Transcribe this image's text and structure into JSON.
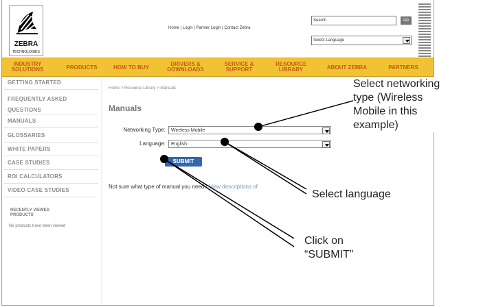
{
  "header": {
    "logo_text": "ZEBRA",
    "logo_subtext": "TECHNOLOGIES",
    "links": "Home | Login | Partner Login | Contact Zebra",
    "search_text": "Search",
    "go_label": "GO",
    "language_select": "Select Language"
  },
  "nav": {
    "items": [
      "INDUSTRY\nSOLUTIONS",
      "PRODUCTS",
      "HOW TO BUY",
      "DRIVERS &\nDOWNLOADS",
      "SERVICE &\nSUPPORT",
      "RESOURCE\nLIBRARY",
      "ABOUT ZEBRA",
      "PARTNERS"
    ]
  },
  "sidebar": {
    "items": [
      "GETTING STARTED",
      "FREQUENTLY ASKED\nQUESTIONS",
      "MANUALS",
      "GLOSSARIES",
      "WHITE PAPERS",
      "CASE STUDIES",
      "ROI CALCULATORS",
      "VIDEO CASE STUDIES"
    ],
    "recent_title": "RECENTLY VIEWED\nPRODUCTS",
    "recent_text": "No products have been viewed"
  },
  "main": {
    "breadcrumb": "Home > Resource Library > Manuals",
    "title": "Manuals",
    "networking_label": "Networking Type:",
    "networking_value": "Wireless Mobile",
    "language_label": "Language:",
    "language_value": "English",
    "submit_label": "SUBMIT",
    "note_prefix": "Not sure what type of manual you need?",
    "note_link": "View descriptions of"
  },
  "annotations": {
    "networking": "Select networking\ntype (Wireless\nMobile in this\nexample)",
    "language": "Select language",
    "submit": "Click on\n“SUBMIT”"
  }
}
